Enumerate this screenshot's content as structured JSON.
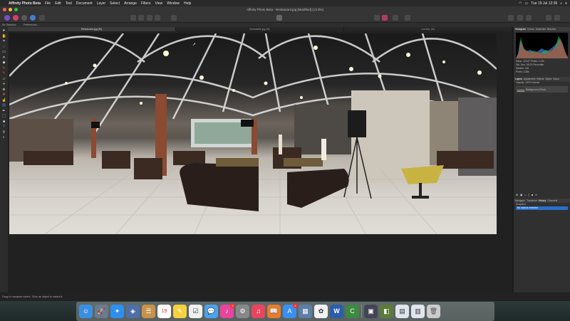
{
  "menubar": {
    "app": "Affinity Photo Beta",
    "items": [
      "File",
      "Edit",
      "Text",
      "Document",
      "Layer",
      "Select",
      "Arrange",
      "Filters",
      "View",
      "Window",
      "Help"
    ],
    "clock": "Tue 19 Jul 12:36"
  },
  "toolbar": {
    "document_title": "Affinity Photo Beta - Restaurant.jpg [Modified] (13.3%)"
  },
  "context": {
    "selection": "No Selection",
    "preferences": "Preferences..."
  },
  "tabs": [
    {
      "label": "Restaurant.jpg (M)",
      "active": true
    },
    {
      "label": "Boardwalk.jpg (M)",
      "active": false
    },
    {
      "label": "Corridor (M)",
      "active": false
    }
  ],
  "panel": {
    "top_tabs": [
      "Histogram",
      "Colour",
      "Swatches",
      "Brushes"
    ],
    "info_rows": [
      "Mean: 120.67   Pixels: 1.04k",
      "Std. Dev.: 88.21   Percentile:",
      "Median: 128",
      "Pixels: 2.85k"
    ],
    "layers_tabs": [
      "Layers",
      "Adjustment",
      "Effects",
      "Styles",
      "Stock"
    ],
    "opacity": "Opacity: 100%   Normal",
    "layer_name": "Background (Pixel)",
    "history_tabs": [
      "Navigator",
      "Transform",
      "History",
      "Channels"
    ],
    "history_section": "Snapshot",
    "history_selected": "No actions selected"
  },
  "status": {
    "hint": "Drag to marquee select. Click an object to select it."
  },
  "dock": {
    "calendar_day": "19",
    "mail_badge": "2",
    "appstore_badge": "1",
    "word_label": "W"
  },
  "colors": {
    "menubar": "#2a2a2a",
    "selection_blue": "#2a6fc9",
    "close": "#ff5f57",
    "minimize": "#febc2e",
    "zoom": "#28c840"
  }
}
